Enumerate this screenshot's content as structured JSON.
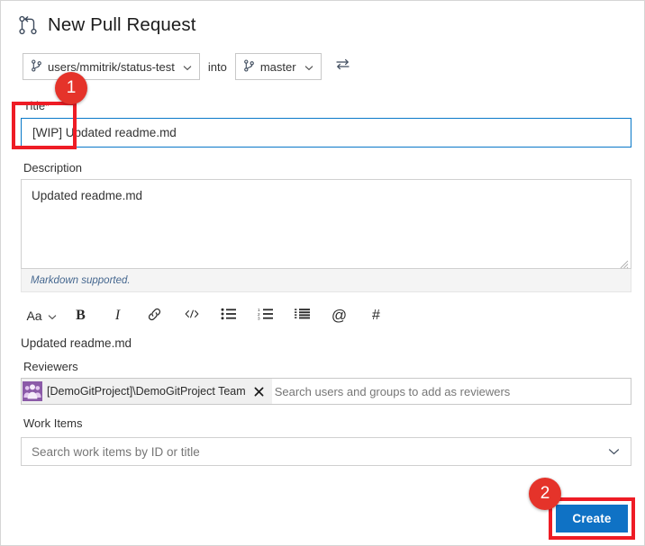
{
  "window": {
    "title": "New Pull Request",
    "title_icon": "pull-request-icon"
  },
  "branches": {
    "source": {
      "value": "users/mmitrik/status-test",
      "icon": "branch-icon",
      "chevron": "chevron-down-icon"
    },
    "into_label": "into",
    "target": {
      "value": "master",
      "icon": "branch-icon",
      "chevron": "chevron-down-icon"
    },
    "swap_icon": "swap-arrows-icon"
  },
  "form": {
    "title": {
      "label": "Title",
      "required_marker": "*",
      "value": "[WIP] Updated readme.md"
    },
    "description": {
      "label": "Description",
      "value": "Updated readme.md",
      "markdown_note": "Markdown supported.",
      "resize_handle_icon": "resize-grip-icon"
    },
    "markdown_toolbar": [
      {
        "name": "font-size-button",
        "glyph": "Aa",
        "icon": "font-size-icon",
        "has_chevron": true
      },
      {
        "name": "bold-button",
        "glyph": "B",
        "icon": "bold-icon",
        "has_chevron": false
      },
      {
        "name": "italic-button",
        "glyph": "I",
        "icon": "italic-icon",
        "has_chevron": false
      },
      {
        "name": "link-button",
        "glyph": "",
        "icon": "link-icon",
        "has_chevron": false
      },
      {
        "name": "code-button",
        "glyph": "",
        "icon": "code-icon",
        "has_chevron": false
      },
      {
        "name": "bulleted-list-button",
        "glyph": "",
        "icon": "bulleted-list-icon",
        "has_chevron": false
      },
      {
        "name": "numbered-list-button",
        "glyph": "",
        "icon": "numbered-list-icon",
        "has_chevron": false
      },
      {
        "name": "indent-list-button",
        "glyph": "",
        "icon": "indent-list-icon",
        "has_chevron": false
      },
      {
        "name": "mention-button",
        "glyph": "@",
        "icon": "mention-icon",
        "has_chevron": false
      },
      {
        "name": "hashtag-button",
        "glyph": "#",
        "icon": "hashtag-icon",
        "has_chevron": false
      }
    ],
    "preview_text": "Updated readme.md",
    "reviewers": {
      "label": "Reviewers",
      "chip": {
        "name": "[DemoGitProject]\\DemoGitProject Team",
        "avatar_icon": "team-group-icon",
        "remove_icon": "close-x-icon"
      },
      "placeholder": "Search users and groups to add as reviewers"
    },
    "work_items": {
      "label": "Work Items",
      "placeholder": "Search work items by ID or title",
      "chevron": "chevron-down-icon"
    }
  },
  "actions": {
    "create_label": "Create"
  },
  "annotations": {
    "badge_one": "1",
    "badge_two": "2"
  },
  "colors": {
    "accent_blue": "#0f72c5",
    "focus_border": "#0878c8",
    "annotation_red": "#ee1c25",
    "badge_red": "#e5332a",
    "markdown_note": "#45678f",
    "required_star": "#c4161c",
    "avatar_purple": "#8b5aa8"
  }
}
